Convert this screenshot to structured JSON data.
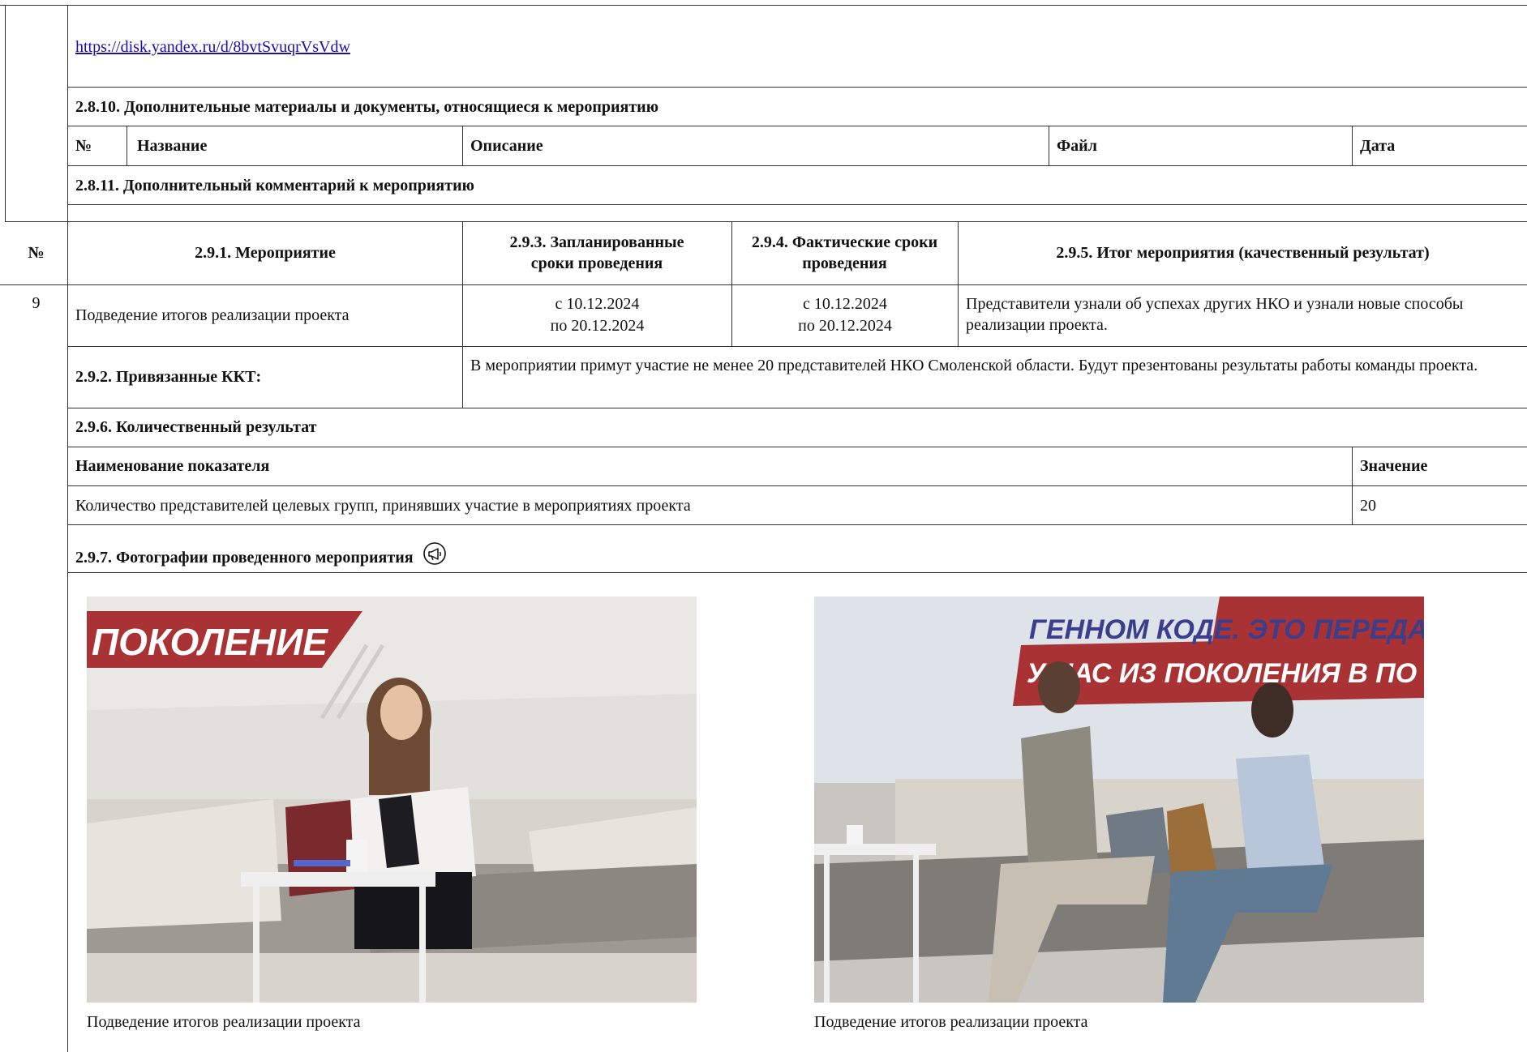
{
  "links": {
    "yadisk": "https://disk.yandex.ru/d/8bvtSvuqrVsVdw"
  },
  "sec_2_8_10": {
    "title": "2.8.10. Дополнительные материалы и документы, относящиеся к мероприятию",
    "columns": [
      "№",
      "Название",
      "Описание",
      "Файл",
      "Дата"
    ]
  },
  "sec_2_8_11": {
    "title": "2.8.11. Дополнительный комментарий к мероприятию"
  },
  "main_table": {
    "headers": {
      "num": "№",
      "event": "2.9.1. Мероприятие",
      "planned": "2.9.3. Запланированные сроки проведения",
      "actual": "2.9.4. Фактические сроки проведения",
      "result": "2.9.5. Итог мероприятия (качественный результат)"
    },
    "row": {
      "num": "9",
      "event": "Подведение итогов реализации проекта",
      "planned_from": "с 10.12.2024",
      "planned_to": "по 20.12.2024",
      "actual_from": "с 10.12.2024",
      "actual_to": "по 20.12.2024",
      "result": "Представители узнали об успехах других НКО и узнали новые способы реализации проекта."
    }
  },
  "kkt": {
    "label": "2.9.2. Привязанные ККТ:",
    "text": "В мероприятии примут участие не менее 20 представителей НКО Смоленской области. Будут презентованы результаты работы команды проекта."
  },
  "quant": {
    "title": "2.9.6. Количественный результат",
    "col_name": "Наименование показателя",
    "col_value": "Значение",
    "rows": [
      {
        "name": "Количество представителей целевых групп, принявших участие в мероприятиях проекта",
        "value": "20"
      }
    ]
  },
  "photos": {
    "title": "2.9.7. Фотографии проведенного мероприятия",
    "icon": "megaphone-icon",
    "items": [
      {
        "caption": "Подведение итогов реализации проекта",
        "banner": "ПОКОЛЕНИЕ"
      },
      {
        "caption": "Подведение итогов реализации проекта",
        "banner_line1": "ГЕННОМ КОДЕ. ЭТО ПЕРЕДА",
        "banner_line2": "У НАС ИЗ ПОКОЛЕНИЯ В ПО"
      }
    ]
  },
  "colors": {
    "banner_red": "#a93234",
    "border": "#333333",
    "link": "#1a0dab"
  }
}
